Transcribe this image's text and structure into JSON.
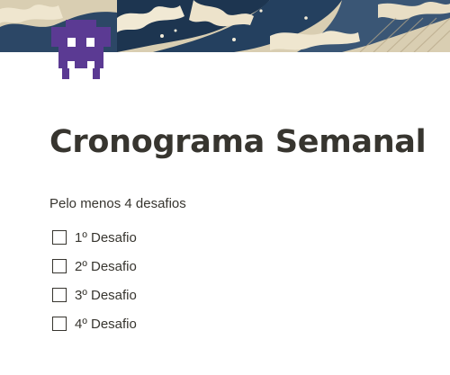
{
  "page": {
    "title": "Cronograma Semanal",
    "icon": "space-invader-icon",
    "cover": "great-wave-cover-image"
  },
  "intro": {
    "text": "Pelo menos 4 desafios"
  },
  "todos": [
    {
      "label": "1º Desafio",
      "checked": false
    },
    {
      "label": "2º Desafio",
      "checked": false
    },
    {
      "label": "3º Desafio",
      "checked": false
    },
    {
      "label": "4º Desafio",
      "checked": false
    }
  ],
  "colors": {
    "text": "#37352f",
    "icon": "#5b3a93",
    "cover_navy": "#1d3550",
    "cover_cream": "#e6dcc4"
  }
}
